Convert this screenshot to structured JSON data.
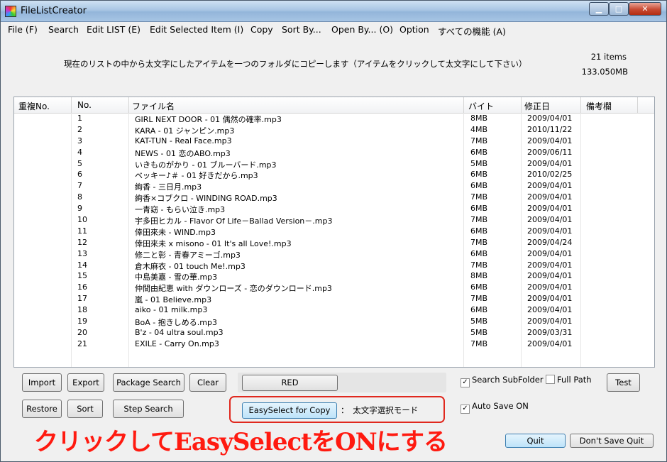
{
  "window": {
    "title": "FileListCreator"
  },
  "menu": [
    "File (F)",
    "Search",
    "Edit LIST (E)",
    "Edit Selected Item (I)",
    "Copy",
    "Sort By...",
    "Open By... (O)",
    "Option",
    "すべての機能 (A)"
  ],
  "info": {
    "text": "現在のリストの中から太文字にしたアイテムを一つのフォルダにコピーします（アイテムをクリックして太文字にして下さい）",
    "count": "21 items",
    "size": "133.050MB"
  },
  "columns": [
    "重複No.",
    "No.",
    "ファイル名",
    "バイト",
    "修正日",
    "備考欄"
  ],
  "rows": [
    {
      "no": "1",
      "name": "GIRL NEXT DOOR - 01 偶然の確率.mp3",
      "byte": "8MB",
      "date": "2009/04/01"
    },
    {
      "no": "2",
      "name": "KARA - 01 ジャンピン.mp3",
      "byte": "4MB",
      "date": "2010/11/22"
    },
    {
      "no": "3",
      "name": "KAT-TUN - Real Face.mp3",
      "byte": "7MB",
      "date": "2009/04/01"
    },
    {
      "no": "4",
      "name": "NEWS - 01 恋のABO.mp3",
      "byte": "6MB",
      "date": "2009/06/11"
    },
    {
      "no": "5",
      "name": "いきものがかり - 01 ブルーバード.mp3",
      "byte": "5MB",
      "date": "2009/04/01"
    },
    {
      "no": "6",
      "name": "ベッキー♪＃ - 01 好きだから.mp3",
      "byte": "6MB",
      "date": "2010/02/25"
    },
    {
      "no": "7",
      "name": "絢香 - 三日月.mp3",
      "byte": "6MB",
      "date": "2009/04/01"
    },
    {
      "no": "8",
      "name": "絢香×コブクロ - WINDING ROAD.mp3",
      "byte": "7MB",
      "date": "2009/04/01"
    },
    {
      "no": "9",
      "name": "一青窈 - もらい泣き.mp3",
      "byte": "6MB",
      "date": "2009/04/01"
    },
    {
      "no": "10",
      "name": "宇多田ヒカル - Flavor Of Life－Ballad Version－.mp3",
      "byte": "7MB",
      "date": "2009/04/01"
    },
    {
      "no": "11",
      "name": "倖田來未 - WIND.mp3",
      "byte": "6MB",
      "date": "2009/04/01"
    },
    {
      "no": "12",
      "name": "倖田來未 x misono - 01 It's all Love!.mp3",
      "byte": "7MB",
      "date": "2009/04/24"
    },
    {
      "no": "13",
      "name": "修二と彰 - 青春アミーゴ.mp3",
      "byte": "6MB",
      "date": "2009/04/01"
    },
    {
      "no": "14",
      "name": "倉木麻衣 - 01 touch Me!.mp3",
      "byte": "7MB",
      "date": "2009/04/01"
    },
    {
      "no": "15",
      "name": "中島美嘉 - 雪の華.mp3",
      "byte": "8MB",
      "date": "2009/04/01"
    },
    {
      "no": "16",
      "name": "仲間由紀恵 with ダウンローズ - 恋のダウンロード.mp3",
      "byte": "6MB",
      "date": "2009/04/01"
    },
    {
      "no": "17",
      "name": "嵐 - 01 Believe.mp3",
      "byte": "7MB",
      "date": "2009/04/01"
    },
    {
      "no": "18",
      "name": "aiko - 01 milk.mp3",
      "byte": "6MB",
      "date": "2009/04/01"
    },
    {
      "no": "19",
      "name": "BoA - 抱きしめる.mp3",
      "byte": "5MB",
      "date": "2009/04/01"
    },
    {
      "no": "20",
      "name": "B'z - 04 ultra soul.mp3",
      "byte": "5MB",
      "date": "2009/03/31"
    },
    {
      "no": "21",
      "name": "EXILE - Carry On.mp3",
      "byte": "7MB",
      "date": "2009/04/01"
    }
  ],
  "buttons": {
    "import": "Import",
    "export": "Export",
    "package_search": "Package Search",
    "clear": "Clear",
    "restore": "Restore",
    "sort": "Sort",
    "step_search": "Step Search",
    "red": "RED",
    "easyselect": "EasySelect for Copy",
    "test": "Test",
    "quit": "Quit",
    "dont_save_quit": "Don't Save Quit"
  },
  "checks": {
    "search_subfolder": {
      "label": "Search SubFolder",
      "checked": true
    },
    "full_path": {
      "label": "Full Path",
      "checked": false
    },
    "auto_save": {
      "label": "Auto Save ON",
      "checked": true
    }
  },
  "mode_text": "：　太文字選択モード",
  "annotation": "クリックしてEasySelectをONにする",
  "colors": {
    "annotation": "#ff1a10",
    "frame": "#e0281e"
  }
}
